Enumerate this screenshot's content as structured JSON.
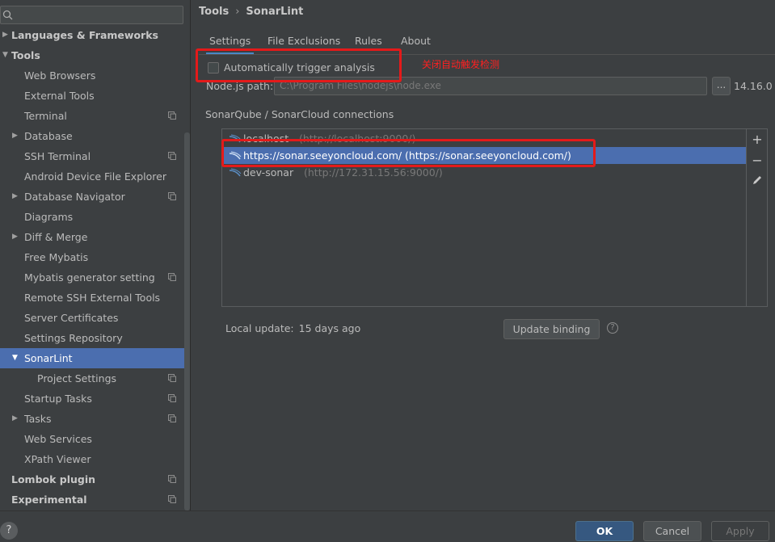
{
  "search": {
    "value": "",
    "placeholder": ""
  },
  "sidebar": {
    "items": [
      {
        "label": "Languages & Frameworks",
        "bold": true,
        "arrow": "▶",
        "depth": 0
      },
      {
        "label": "Tools",
        "bold": true,
        "arrow": "▼",
        "depth": 0
      },
      {
        "label": "Web Browsers",
        "depth": 1
      },
      {
        "label": "External Tools",
        "depth": 1
      },
      {
        "label": "Terminal",
        "depth": 1,
        "proj": true
      },
      {
        "label": "Database",
        "depth": 1,
        "arrow": "▶"
      },
      {
        "label": "SSH Terminal",
        "depth": 1,
        "proj": true
      },
      {
        "label": "Android Device File Explorer",
        "depth": 1
      },
      {
        "label": "Database Navigator",
        "depth": 1,
        "arrow": "▶",
        "proj": true
      },
      {
        "label": "Diagrams",
        "depth": 1
      },
      {
        "label": "Diff & Merge",
        "depth": 1,
        "arrow": "▶"
      },
      {
        "label": "Free Mybatis",
        "depth": 1
      },
      {
        "label": "Mybatis generator setting",
        "depth": 1,
        "proj": true
      },
      {
        "label": "Remote SSH External Tools",
        "depth": 1
      },
      {
        "label": "Server Certificates",
        "depth": 1
      },
      {
        "label": "Settings Repository",
        "depth": 1
      },
      {
        "label": "SonarLint",
        "depth": 1,
        "arrow": "▼",
        "selected": true
      },
      {
        "label": "Project Settings",
        "depth": 2,
        "proj": true
      },
      {
        "label": "Startup Tasks",
        "depth": 1,
        "proj": true
      },
      {
        "label": "Tasks",
        "depth": 1,
        "arrow": "▶",
        "proj": true
      },
      {
        "label": "Web Services",
        "depth": 1
      },
      {
        "label": "XPath Viewer",
        "depth": 1
      },
      {
        "label": "Lombok plugin",
        "bold": true,
        "depth": 0,
        "proj": true
      },
      {
        "label": "Experimental",
        "bold": true,
        "depth": 0,
        "proj": true
      }
    ]
  },
  "breadcrumb": {
    "parent": "Tools",
    "separator": "›",
    "current": "SonarLint"
  },
  "tabs": [
    {
      "label": "Settings",
      "active": true
    },
    {
      "label": "File Exclusions"
    },
    {
      "label": "Rules"
    },
    {
      "label": "About"
    }
  ],
  "settings": {
    "auto_trigger_label": "Automatically trigger analysis",
    "auto_trigger_checked": false,
    "annotation": "关闭自动触发检测",
    "node_label": "Node.js path:",
    "node_path_placeholder": "C:\\Program Files\\nodejs\\node.exe",
    "browse_label": "...",
    "node_version": "14.16.0",
    "connections_title": "SonarQube / SonarCloud connections",
    "connections": [
      {
        "name": "localhost",
        "url": "(http://localhost:9000/)"
      },
      {
        "name": "https://sonar.seeyoncloud.com/",
        "url": "(https://sonar.seeyoncloud.com/)",
        "selected": true
      },
      {
        "name": "dev-sonar",
        "url": "(http://172.31.15.56:9000/)"
      }
    ],
    "add_label": "+",
    "remove_label": "−",
    "local_update_label": "Local update:",
    "local_update_value": "15 days ago",
    "update_binding_label": "Update binding",
    "help_small": "?"
  },
  "footer": {
    "help": "?",
    "ok": "OK",
    "cancel": "Cancel",
    "apply": "Apply"
  },
  "colors": {
    "selection": "#4b6eaf",
    "annotation": "#e41a1a",
    "tab_indicator": "#4a88c7"
  }
}
